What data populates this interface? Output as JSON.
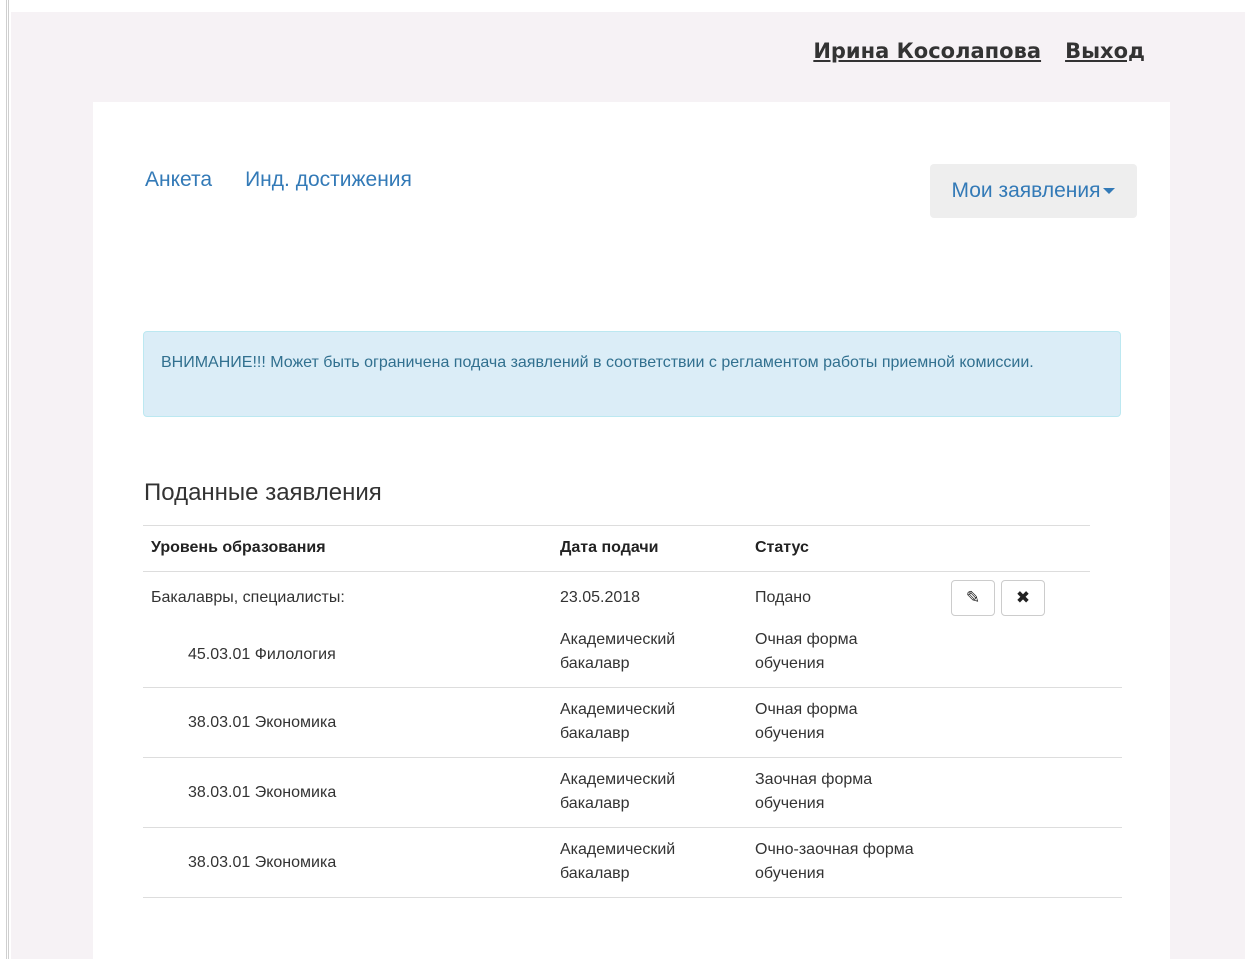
{
  "header": {
    "user_name": "Ирина Косолапова",
    "logout_label": "Выход"
  },
  "nav": {
    "items": [
      {
        "label": "Анкета"
      },
      {
        "label": "Инд. достижения"
      }
    ],
    "dropdown_label": "Мои заявления"
  },
  "alert": {
    "text": "ВНИМАНИЕ!!! Может быть ограничена подача заявлений в соответствии с регламентом работы приемной комиссии."
  },
  "applications": {
    "title": "Поданные заявления",
    "columns": {
      "level": "Уровень образования",
      "date": "Дата подачи",
      "status": "Статус"
    },
    "group": {
      "level": "Бакалавры, специалисты:",
      "date": "23.05.2018",
      "status": "Подано",
      "edit_icon": "pencil-icon",
      "delete_icon": "close-icon"
    },
    "programs": [
      {
        "name": "45.03.01 Филология",
        "type_line1": "Академический",
        "type_line2": "бакалавр",
        "form_line1": "Очная форма",
        "form_line2": "обучения"
      },
      {
        "name": "38.03.01 Экономика",
        "type_line1": "Академический",
        "type_line2": "бакалавр",
        "form_line1": "Очная форма",
        "form_line2": "обучения"
      },
      {
        "name": "38.03.01 Экономика",
        "type_line1": "Академический",
        "type_line2": "бакалавр",
        "form_line1": "Заочная форма",
        "form_line2": "обучения"
      },
      {
        "name": "38.03.01 Экономика",
        "type_line1": "Академический",
        "type_line2": "бакалавр",
        "form_line1": "Очно-заочная форма",
        "form_line2": "обучения"
      }
    ]
  },
  "colors": {
    "link": "#337ab7",
    "alert_bg": "#dbedf7",
    "alert_text": "#31708f",
    "page_bg": "#f6f2f5"
  }
}
